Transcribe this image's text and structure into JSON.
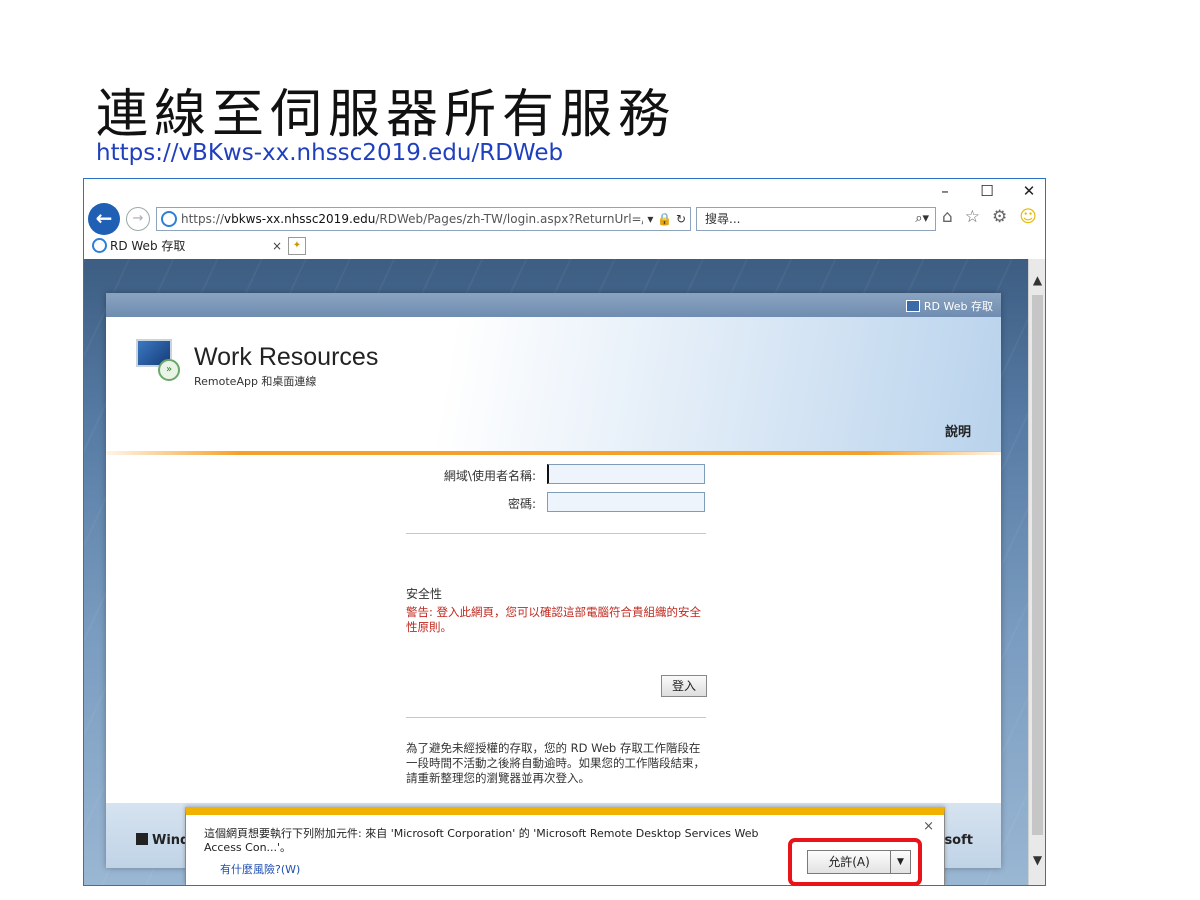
{
  "slide": {
    "title": "連線至伺服器所有服務",
    "url": "https://vBKws-xx.nhssc2019.edu/RDWeb"
  },
  "browser": {
    "window_controls": {
      "minimize": "–",
      "maximize": "☐",
      "close": "✕"
    },
    "address_bar": {
      "scheme": "https://",
      "host": "vbkws-xx.nhssc2019.edu",
      "path": "/RDWeb/Pages/zh-TW/login.aspx?ReturnUrl=/RI",
      "controls": "▾ 🔒 ↻"
    },
    "search_placeholder": "搜尋...",
    "search_icon": "⌕▾",
    "tab": {
      "label": "RD Web 存取",
      "close": "×"
    }
  },
  "rdweb": {
    "top_label": "RD Web 存取",
    "title": "Work Resources",
    "subtitle": "RemoteApp 和桌面連線",
    "help": "說明",
    "form": {
      "username_label": "網域\\使用者名稱:",
      "password_label": "密碼:",
      "username_value": "",
      "password_value": ""
    },
    "security_title": "安全性",
    "security_warning": "警告: 登入此網頁，您可以確認這部電腦符合貴組織的安全性原則。",
    "login_button": "登入",
    "timeout_note": "為了避免未經授權的存取，您的 RD Web 存取工作階段在一段時間不活動之後將自動逾時。如果您的工作階段結束，請重新整理您的瀏覽器並再次登入。",
    "footer_left": "Windo",
    "footer_right": "osoft"
  },
  "notification": {
    "message": "這個網頁想要執行下列附加元件: 來自 'Microsoft Corporation' 的 'Microsoft Remote Desktop Services Web Access Con...'。",
    "risk_link": "有什麼風險?(W)",
    "allow_button": "允許(A)",
    "dropdown": "▼",
    "close": "×"
  },
  "colors": {
    "highlight": "#e8141a",
    "notification_bar": "#f0b100",
    "url_text": "#1f3fbf",
    "warning_text": "#c0281e"
  }
}
